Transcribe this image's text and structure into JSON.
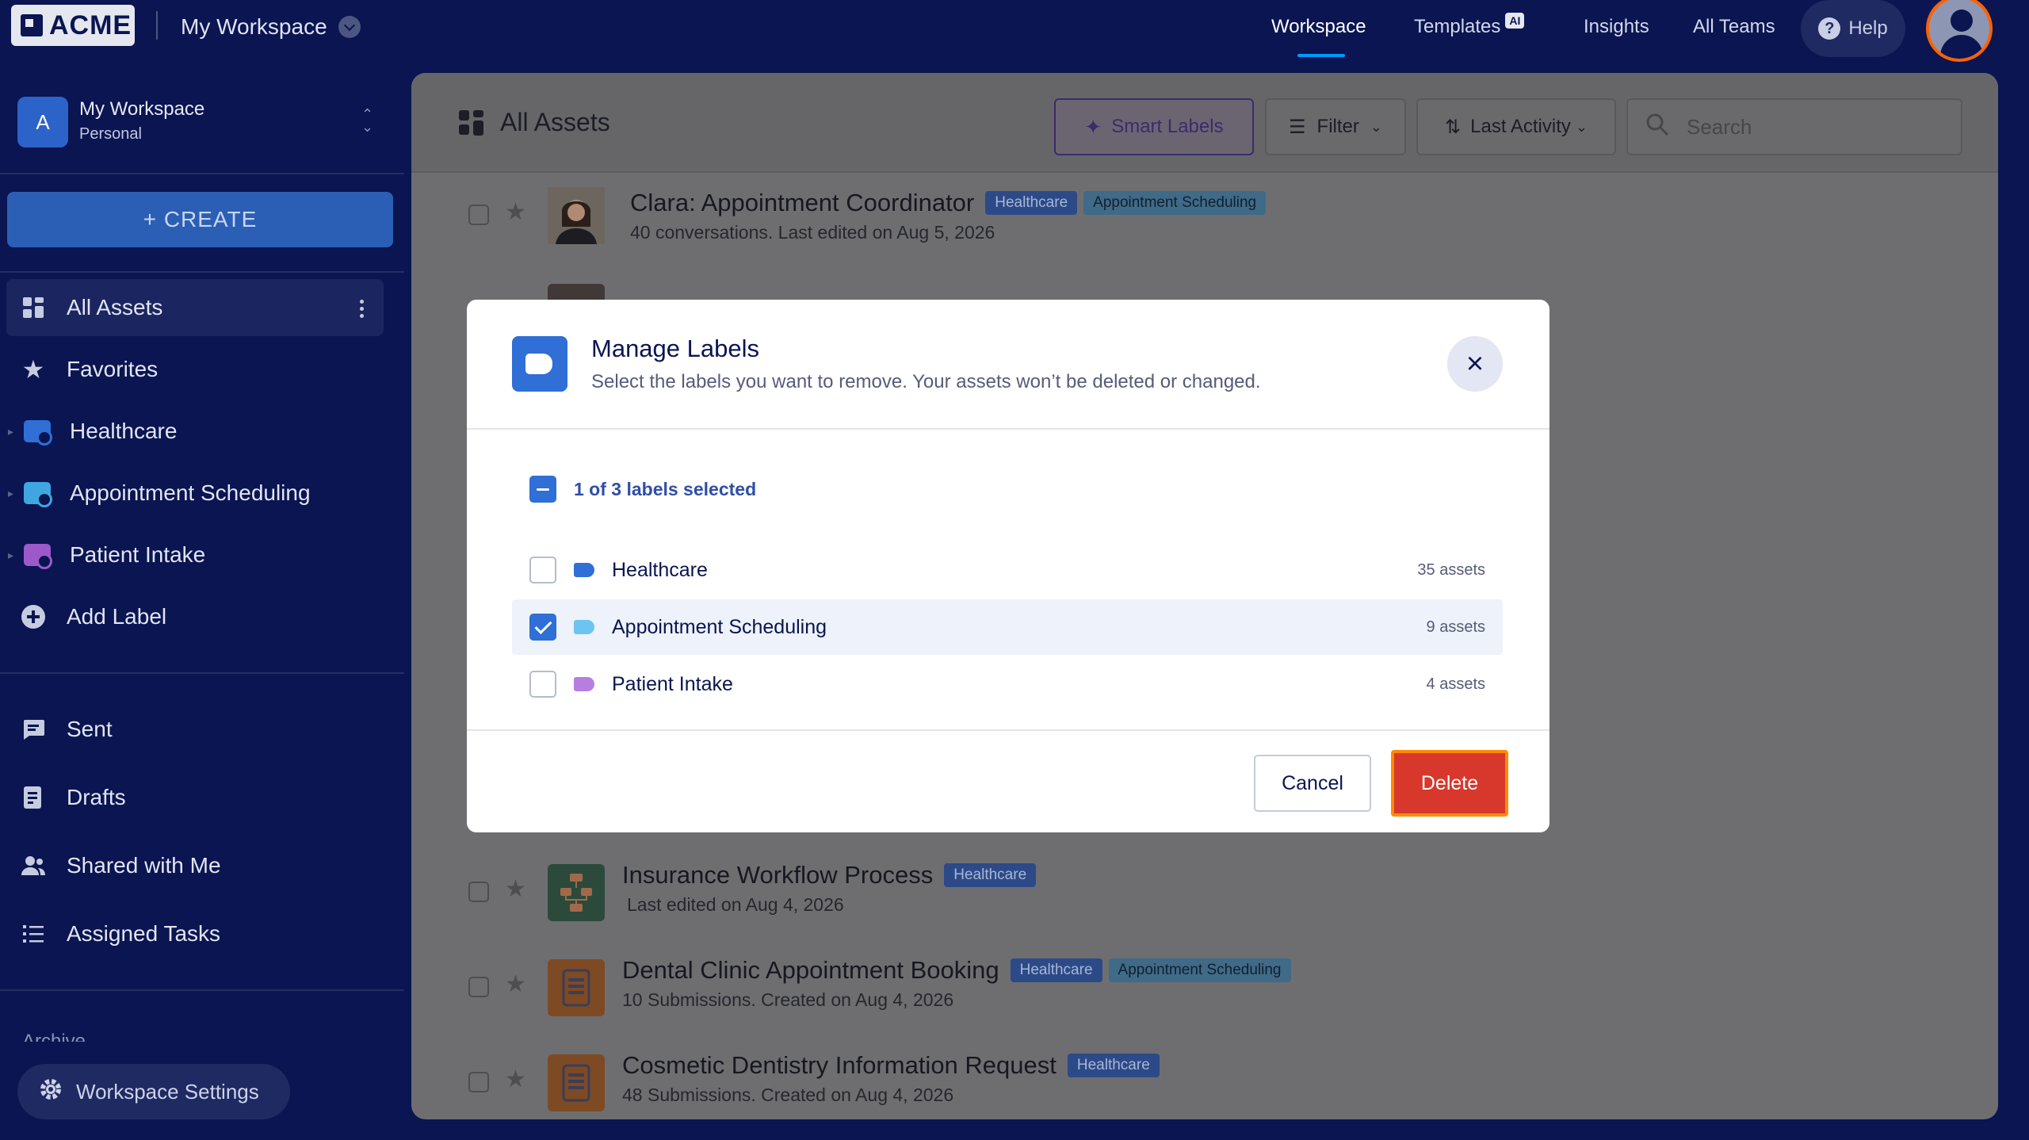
{
  "topbar": {
    "logo": "ACME",
    "workspace": "My Workspace",
    "nav": [
      {
        "label": "Workspace"
      },
      {
        "label": "Templates",
        "badge": "AI"
      },
      {
        "label": "Insights"
      },
      {
        "label": "All Teams"
      }
    ],
    "help": "Help"
  },
  "sidebar": {
    "workspace_initial": "A",
    "workspace_name": "My Workspace",
    "workspace_type": "Personal",
    "create": "+ CREATE",
    "items": [
      {
        "label": "All Assets"
      },
      {
        "label": "Favorites"
      },
      {
        "label": "Healthcare",
        "color": "#2f6fd6"
      },
      {
        "label": "Appointment Scheduling",
        "color": "#3fa6e0"
      },
      {
        "label": "Patient Intake",
        "color": "#9b59c9"
      },
      {
        "label": "Add Label"
      }
    ],
    "items2": [
      {
        "label": "Sent"
      },
      {
        "label": "Drafts"
      },
      {
        "label": "Shared with Me"
      },
      {
        "label": "Assigned Tasks"
      }
    ],
    "archive_peek": "Archive",
    "settings": "Workspace Settings"
  },
  "main": {
    "title": "All Assets",
    "smart_labels": "Smart Labels",
    "filter": "Filter",
    "sort": "Last Activity",
    "search_placeholder": "Search",
    "rows": [
      {
        "title": "Clara: Appointment Coordinator",
        "tags": [
          "Healthcare",
          "Appointment Scheduling"
        ],
        "sub": "40 conversations. Last edited on Aug 5, 2026"
      },
      {
        "title": "Insurance Workflow Process",
        "tags": [
          "Healthcare"
        ],
        "sub": "Last edited on Aug 4, 2026"
      },
      {
        "title": "Dental Clinic Appointment Booking",
        "tags": [
          "Healthcare",
          "Appointment Scheduling"
        ],
        "sub": "10 Submissions. Created on Aug 4, 2026"
      },
      {
        "title": "Cosmetic Dentistry Information Request",
        "tags": [
          "Healthcare"
        ],
        "sub": "48 Submissions. Created on Aug 4, 2026"
      }
    ]
  },
  "modal": {
    "title": "Manage Labels",
    "description": "Select the labels you want to remove. Your assets won’t be deleted or changed.",
    "selection_summary": "1 of 3 labels selected",
    "labels": [
      {
        "name": "Healthcare",
        "count": "35 assets",
        "checked": false,
        "color": "#2f6fd6"
      },
      {
        "name": "Appointment Scheduling",
        "count": "9 assets",
        "checked": true,
        "color": "#6cc4f0"
      },
      {
        "name": "Patient Intake",
        "count": "4 assets",
        "checked": false,
        "color": "#b77ee0"
      }
    ],
    "cancel": "Cancel",
    "delete": "Delete"
  }
}
